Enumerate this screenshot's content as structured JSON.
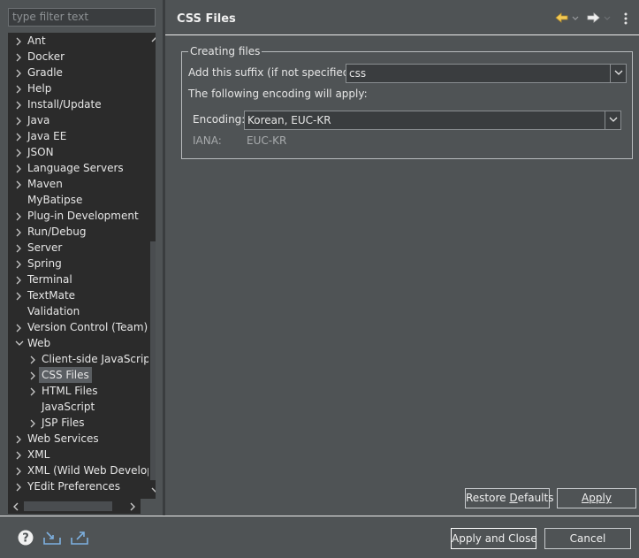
{
  "sidebar": {
    "filter_placeholder": "type filter text",
    "items": [
      {
        "label": "Ant",
        "expandable": true,
        "expanded": false,
        "level": 0
      },
      {
        "label": "Docker",
        "expandable": true,
        "expanded": false,
        "level": 0
      },
      {
        "label": "Gradle",
        "expandable": true,
        "expanded": false,
        "level": 0
      },
      {
        "label": "Help",
        "expandable": true,
        "expanded": false,
        "level": 0
      },
      {
        "label": "Install/Update",
        "expandable": true,
        "expanded": false,
        "level": 0
      },
      {
        "label": "Java",
        "expandable": true,
        "expanded": false,
        "level": 0
      },
      {
        "label": "Java EE",
        "expandable": true,
        "expanded": false,
        "level": 0
      },
      {
        "label": "JSON",
        "expandable": true,
        "expanded": false,
        "level": 0
      },
      {
        "label": "Language Servers",
        "expandable": true,
        "expanded": false,
        "level": 0
      },
      {
        "label": "Maven",
        "expandable": true,
        "expanded": false,
        "level": 0
      },
      {
        "label": "MyBatipse",
        "expandable": false,
        "expanded": false,
        "level": 0
      },
      {
        "label": "Plug-in Development",
        "expandable": true,
        "expanded": false,
        "level": 0
      },
      {
        "label": "Run/Debug",
        "expandable": true,
        "expanded": false,
        "level": 0
      },
      {
        "label": "Server",
        "expandable": true,
        "expanded": false,
        "level": 0
      },
      {
        "label": "Spring",
        "expandable": true,
        "expanded": false,
        "level": 0
      },
      {
        "label": "Terminal",
        "expandable": true,
        "expanded": false,
        "level": 0
      },
      {
        "label": "TextMate",
        "expandable": true,
        "expanded": false,
        "level": 0
      },
      {
        "label": "Validation",
        "expandable": false,
        "expanded": false,
        "level": 0
      },
      {
        "label": "Version Control (Team)",
        "expandable": true,
        "expanded": false,
        "level": 0
      },
      {
        "label": "Web",
        "expandable": true,
        "expanded": true,
        "level": 0
      },
      {
        "label": "Client-side JavaScript",
        "expandable": true,
        "expanded": false,
        "level": 1
      },
      {
        "label": "CSS Files",
        "expandable": true,
        "expanded": false,
        "level": 1,
        "selected": true
      },
      {
        "label": "HTML Files",
        "expandable": true,
        "expanded": false,
        "level": 1
      },
      {
        "label": "JavaScript",
        "expandable": false,
        "expanded": false,
        "level": 1
      },
      {
        "label": "JSP Files",
        "expandable": true,
        "expanded": false,
        "level": 1
      },
      {
        "label": "Web Services",
        "expandable": true,
        "expanded": false,
        "level": 0
      },
      {
        "label": "XML",
        "expandable": true,
        "expanded": false,
        "level": 0
      },
      {
        "label": "XML (Wild Web Developer)",
        "expandable": true,
        "expanded": false,
        "level": 0
      },
      {
        "label": "YEdit Preferences",
        "expandable": true,
        "expanded": false,
        "level": 0
      }
    ]
  },
  "page": {
    "title": "CSS Files",
    "back_icon": "back-arrow-icon",
    "forward_icon": "forward-arrow-icon",
    "menu_icon": "view-menu-icon"
  },
  "creating_files": {
    "group_label": "Creating files",
    "suffix_label": "Add this suffix (if not specified):",
    "suffix_value": "css",
    "encoding_note": "The following encoding will apply:",
    "encoding_label": "Encoding:",
    "encoding_value": "Korean, EUC-KR",
    "iana_label": "IANA:",
    "iana_value": "EUC-KR"
  },
  "buttons": {
    "restore_defaults_pre": "Restore ",
    "restore_defaults_u": "D",
    "restore_defaults_post": "efaults",
    "apply_u": "A",
    "apply_post": "pply",
    "apply_and_close": "Apply and Close",
    "cancel": "Cancel"
  },
  "footer": {
    "icons": [
      "help-icon",
      "import-icon",
      "export-icon"
    ]
  },
  "colors": {
    "background": "#4f5355",
    "tree_background": "#2b2b2b",
    "selection": "#5a5e62",
    "back_arrow": "#f2c955"
  }
}
